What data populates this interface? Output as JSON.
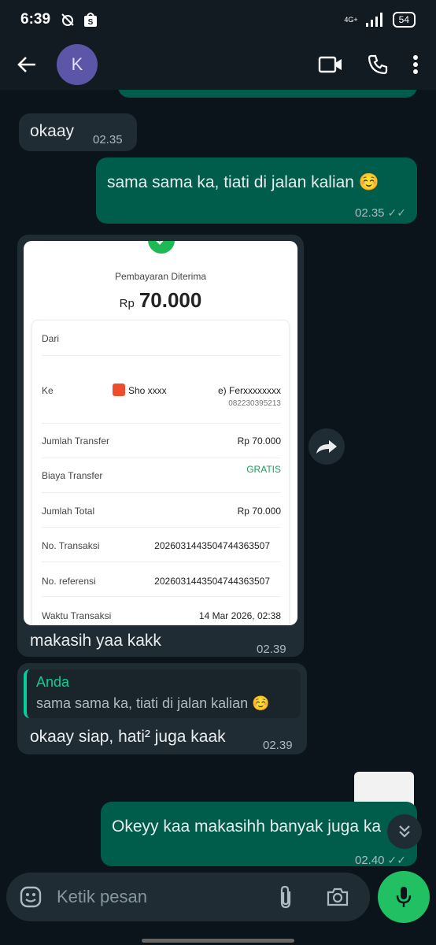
{
  "status_bar": {
    "time": "6:39",
    "network": "4G+",
    "battery": "54"
  },
  "header": {
    "avatar_letter": "K",
    "contact_name": ""
  },
  "messages": {
    "m1": {
      "text": "okaay",
      "time": "02.35"
    },
    "m2": {
      "text": "sama sama ka, tiati di jalan kalian ☺️",
      "time": "02.35"
    },
    "receipt": {
      "title": "Pembayaran Diterima",
      "currency": "Rp",
      "amount": "70.000",
      "rows": {
        "dari_label": "Dari",
        "ke_label": "Ke",
        "ke_value_left": "Sho xxxx",
        "ke_value_right": "e) Ferxxxxxxxx",
        "ke_phone": "082230395213",
        "jumlah_transfer_label": "Jumlah Transfer",
        "jumlah_transfer_value": "Rp 70.000",
        "biaya_transfer_label": "Biaya Transfer",
        "biaya_transfer_value": "GRATIS",
        "jumlah_total_label": "Jumlah Total",
        "jumlah_total_value": "Rp 70.000",
        "no_transaksi_label": "No. Transaksi",
        "no_transaksi_value": "2026031443504744363507",
        "no_referensi_label": "No. referensi",
        "no_referensi_value": "2026031443504744363507",
        "waktu_label": "Waktu Transaksi",
        "waktu_value": "14 Mar 2026, 02:38"
      }
    },
    "m3": {
      "text": "makasih yaa kakk",
      "time": "02.39"
    },
    "m4": {
      "quote_name": "Anda",
      "quote_text": "sama sama ka, tiati di jalan kalian ☺️",
      "text": "okaay siap, hati² juga kaak",
      "time": "02.39"
    },
    "m5": {
      "text": "Okeyy kaa makasihh banyak juga ka",
      "time": "02.40"
    }
  },
  "input": {
    "placeholder": "Ketik pesan"
  },
  "colors": {
    "bubble_out": "#005c4b",
    "bubble_in": "#202c33",
    "accent": "#21c063"
  }
}
